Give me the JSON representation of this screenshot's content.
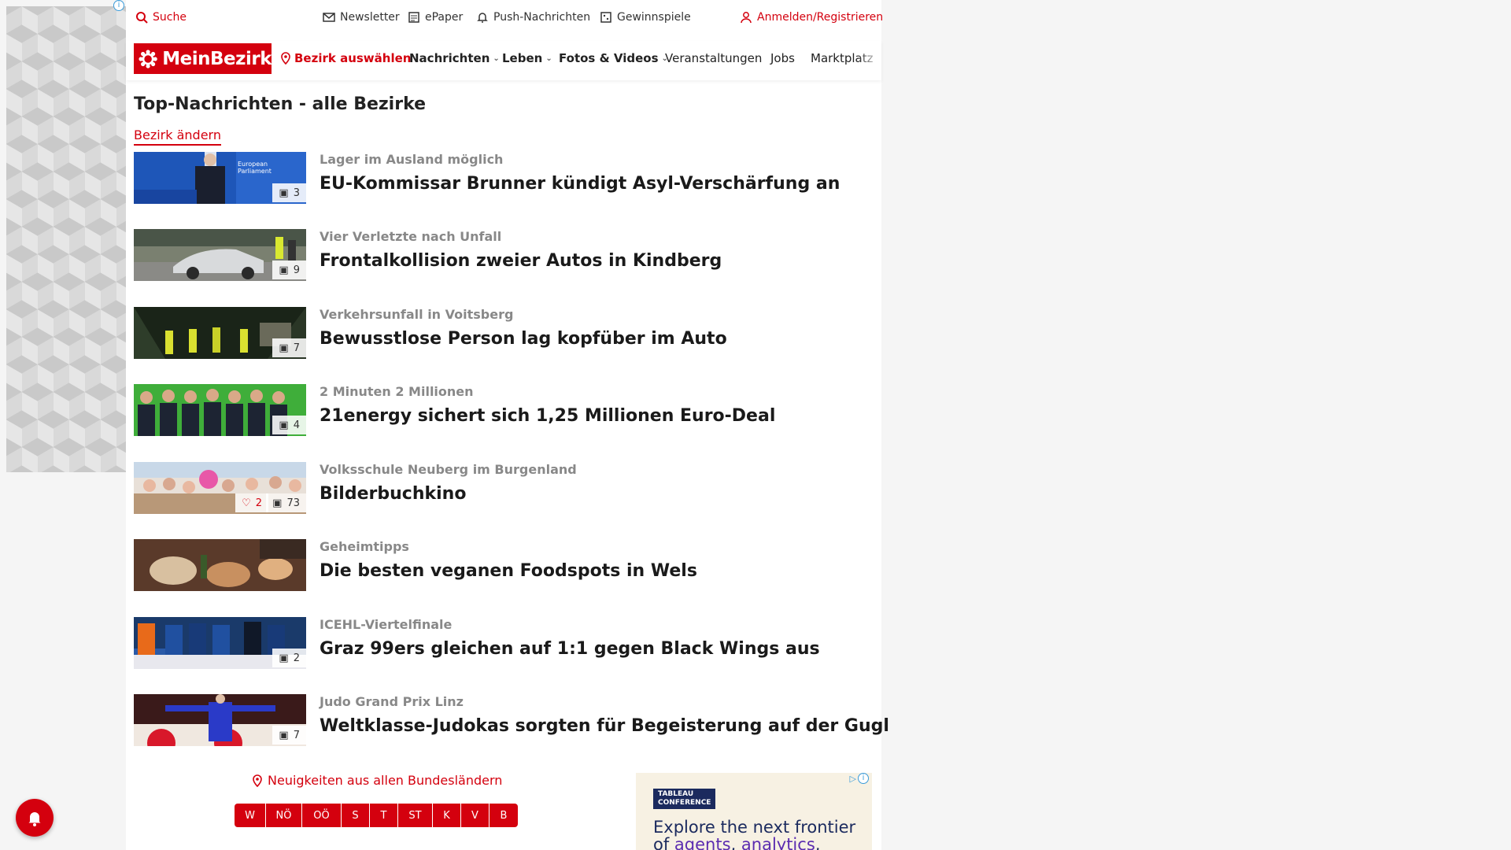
{
  "utility": {
    "search": "Suche",
    "newsletter": "Newsletter",
    "epaper": "ePaper",
    "push": "Push-Nachrichten",
    "contests": "Gewinnspiele",
    "login": "Anmelden/Registrieren"
  },
  "nav": {
    "logo": "MeinBezirk",
    "district": "Bezirk auswählen",
    "items": [
      "Nachrichten",
      "Leben",
      "Fotos & Videos",
      "Veranstaltungen",
      "Jobs",
      "Marktplatz"
    ]
  },
  "page": {
    "title": "Top-Nachrichten - alle Bezirke",
    "change_district": "Bezirk ändern"
  },
  "articles": [
    {
      "kicker": "Lager im Ausland möglich",
      "headline": "EU-Kommissar Brunner kündigt Asyl-Verschärfung an",
      "photos": "3"
    },
    {
      "kicker": "Vier Verletzte nach Unfall",
      "headline": "Frontalkollision zweier Autos in Kindberg",
      "photos": "9"
    },
    {
      "kicker": "Verkehrsunfall in Voitsberg",
      "headline": "Bewusstlose Person lag kopfüber im Auto",
      "photos": "7"
    },
    {
      "kicker": "2 Minuten 2 Millionen",
      "headline": "21energy sichert sich 1,25 Millionen Euro-Deal",
      "photos": "4"
    },
    {
      "kicker": "Volksschule Neuberg im Burgenland",
      "headline": "Bilderbuchkino",
      "photos": "73",
      "likes": "2"
    },
    {
      "kicker": "Geheimtipps",
      "headline": "Die besten veganen Foodspots in Wels",
      "photos": ""
    },
    {
      "kicker": "ICEHL-Viertelfinale",
      "headline": "Graz 99ers gleichen auf 1:1 gegen Black Wings aus",
      "photos": "2"
    },
    {
      "kicker": "Judo Grand Prix Linz",
      "headline": "Weltklasse-Judokas sorgten für Begeisterung auf der Gugl",
      "photos": "7"
    }
  ],
  "states": {
    "link": "Neuigkeiten aus allen Bundesländern",
    "buttons": [
      "W",
      "NÖ",
      "OÖ",
      "S",
      "T",
      "ST",
      "K",
      "V",
      "B"
    ]
  },
  "ad": {
    "logo_line1": "TABLEAU",
    "logo_line2": "CONFERENCE",
    "headline_start": "Explore the next frontier",
    "headline_of": "of ",
    "headline_agents": "agents",
    "headline_comma": ", ",
    "headline_analytics": "analytics",
    "headline_end": ","
  },
  "colors": {
    "brand": "#d4000e",
    "text": "#222222",
    "kicker": "#888888"
  }
}
